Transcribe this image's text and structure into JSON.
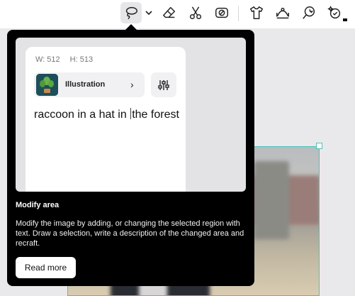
{
  "toolbar": {
    "tools": [
      {
        "name": "lasso-icon",
        "active": true
      },
      {
        "name": "eraser-icon"
      },
      {
        "name": "scissors-icon"
      },
      {
        "name": "inpaint-icon"
      },
      {
        "name": "tshirt-icon"
      },
      {
        "name": "expand-icon"
      },
      {
        "name": "magic-icon"
      },
      {
        "name": "vary-icon"
      }
    ]
  },
  "popover": {
    "preview": {
      "width_label": "W: 512",
      "height_label": "H: 513",
      "style_name": "Illustration",
      "prompt_before_caret": "raccoon in a hat in ",
      "prompt_after_caret": "the forest"
    },
    "title": "Modify area",
    "description": "Modify the image by adding, or changing the selected region with text. Draw a selection, write a description of the changed area and recraft.",
    "read_more_label": "Read more"
  },
  "colors": {
    "selection": "#4cc1b9",
    "popover_bg": "#000000"
  }
}
